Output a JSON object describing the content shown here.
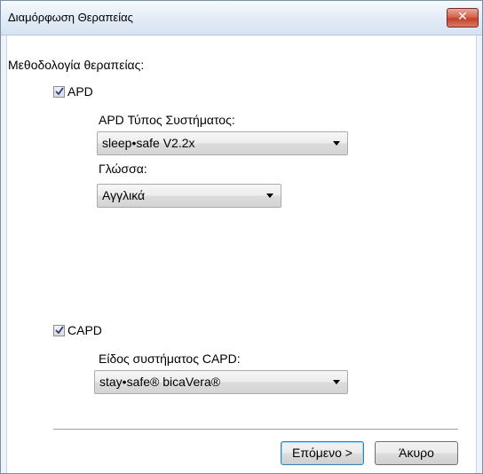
{
  "window": {
    "title": "Διαμόρφωση Θεραπείας",
    "close_glyph": "✕"
  },
  "methodology_label": "Μεθοδολογία θεραπείας:",
  "apd": {
    "checkbox_label": "APD",
    "checked": true,
    "system_type_label": "APD Τύπος Συστήματος:",
    "system_type_value": "sleep•safe V2.2x",
    "language_label": "Γλώσσα:",
    "language_value": "Αγγλικά"
  },
  "capd": {
    "checkbox_label": "CAPD",
    "checked": true,
    "system_type_label": "Είδος συστήματος CAPD:",
    "system_type_value": "stay•safe® bicaVera®"
  },
  "buttons": {
    "next": "Επόμενο >",
    "cancel": "Άκυρο"
  }
}
